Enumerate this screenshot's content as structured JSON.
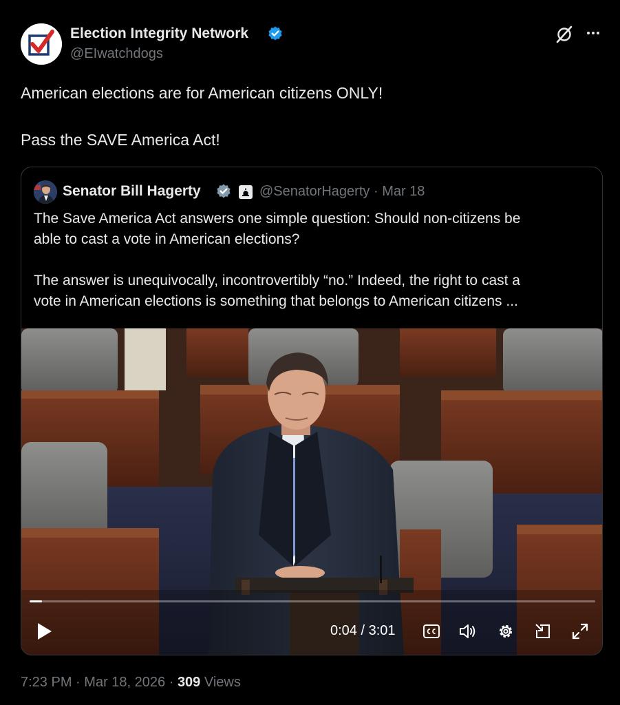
{
  "post": {
    "author_name": "Election Integrity Network",
    "author_handle": "@EIwatchdogs",
    "text_line1": "American elections are for American citizens ONLY!",
    "text_line2": "Pass the SAVE America Act!",
    "time": "7:23 PM",
    "date": "Mar 18, 2026",
    "views_count": "309",
    "views_label": "Views",
    "separator": "·"
  },
  "quoted": {
    "author_name": "Senator Bill Hagerty",
    "author_handle": "@SenatorHagerty",
    "date": "Mar 18",
    "separator": "·",
    "text_line1": "The Save America Act answers one simple question: Should non-citizens be",
    "text_line2": "able to cast a vote in American elections?",
    "text_line3": "The answer is unequivocally, incontrovertibly “no.” Indeed, the right to cast a",
    "text_line4": "vote in American elections is something that belongs to American citizens ..."
  },
  "video": {
    "current_time": "0:04",
    "duration": "3:01",
    "time_display": "0:04 / 3:01",
    "progress": 0.022
  },
  "icons": {
    "verified": "verified-badge-icon",
    "grok": "grok-icon",
    "more": "more-icon",
    "play": "play-icon",
    "captions": "captions-icon",
    "volume": "volume-icon",
    "settings": "settings-icon",
    "pip": "picture-in-picture-icon",
    "fullscreen": "fullscreen-icon"
  },
  "colors": {
    "background": "#000000",
    "text_primary": "#e7e9ea",
    "text_secondary": "#71767b",
    "verified_blue": "#1d9bf0",
    "quote_verified_gray": "#829aab",
    "border": "#333639"
  }
}
